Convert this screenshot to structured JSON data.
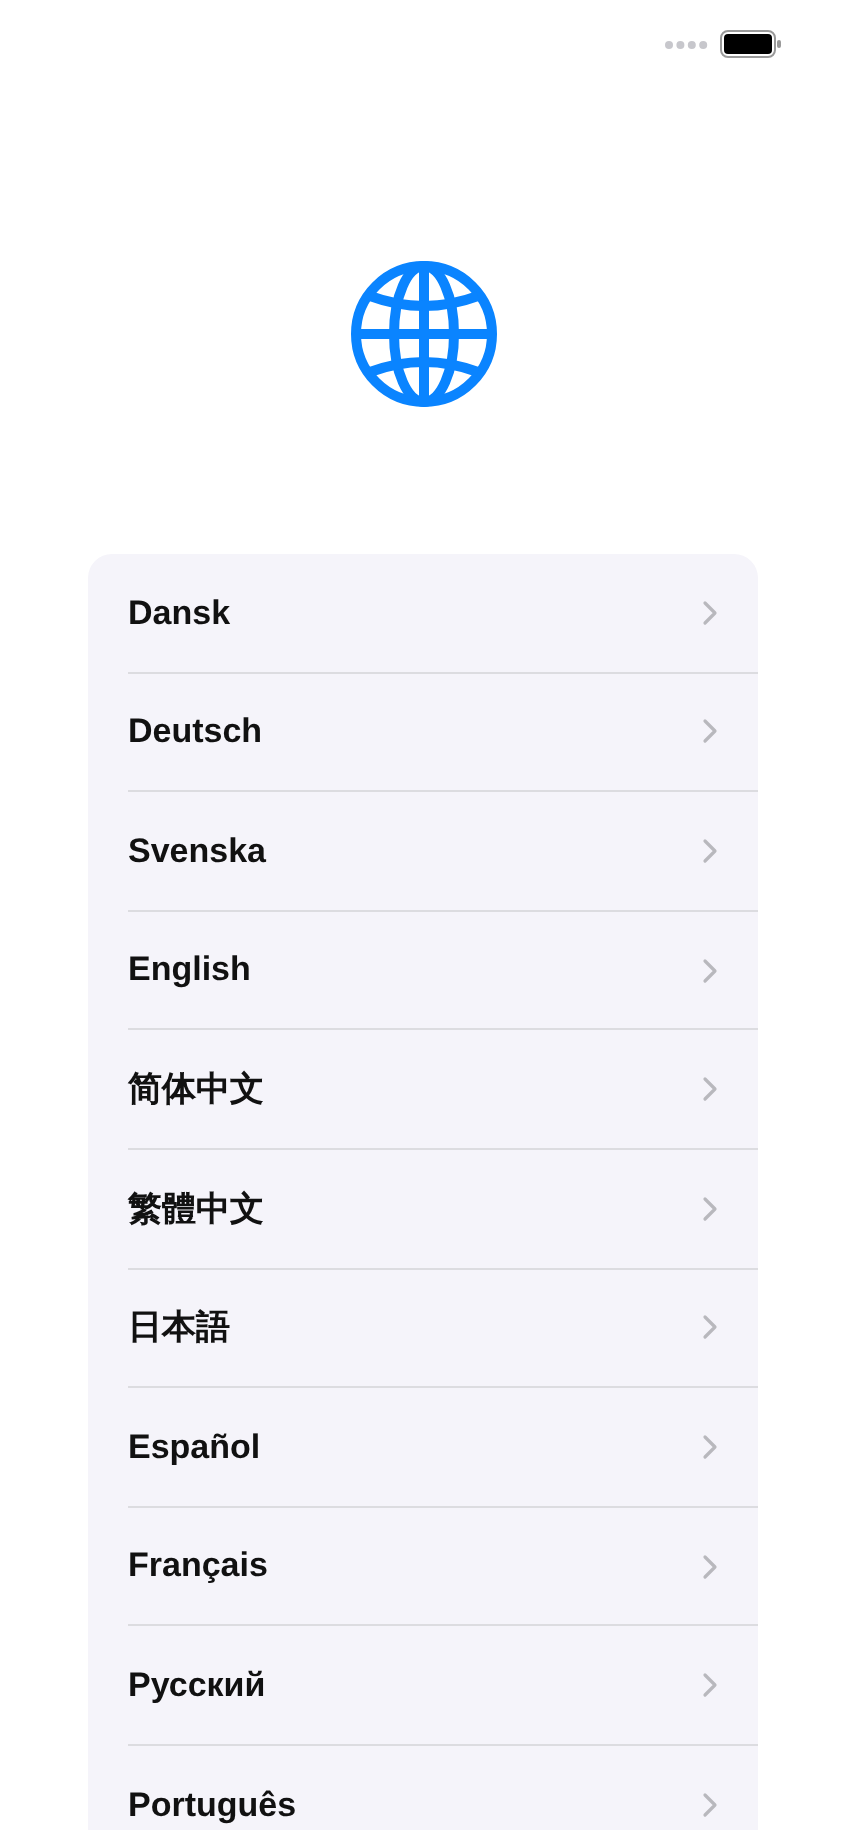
{
  "languages": [
    {
      "label": "Dansk"
    },
    {
      "label": "Deutsch"
    },
    {
      "label": "Svenska"
    },
    {
      "label": "English"
    },
    {
      "label": "简体中文"
    },
    {
      "label": "繁體中文"
    },
    {
      "label": "日本語"
    },
    {
      "label": "Español"
    },
    {
      "label": "Français"
    },
    {
      "label": "Русский"
    },
    {
      "label": "Português"
    }
  ]
}
